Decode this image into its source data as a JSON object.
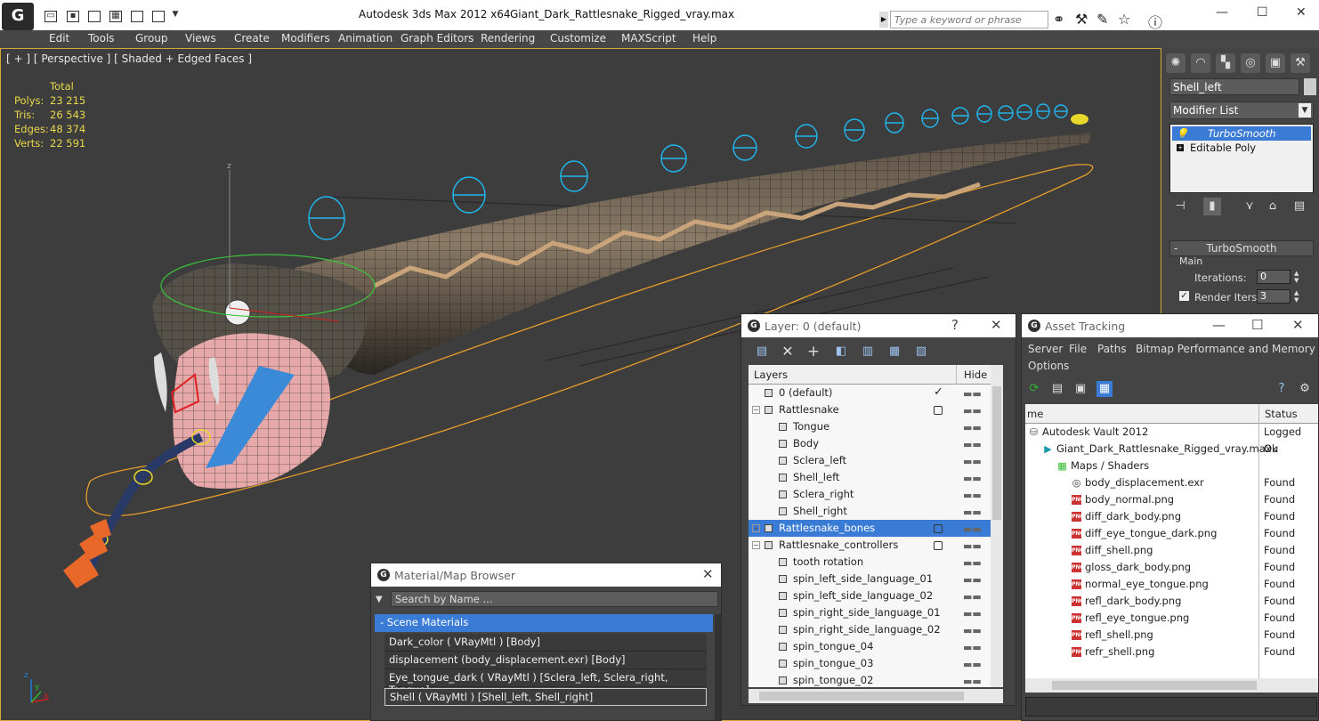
{
  "titlebar": {
    "logo": "G",
    "app_title": "Autodesk 3ds Max  2012 x64",
    "file_title": "Giant_Dark_Rattlesnake_Rigged_vray.max",
    "search_placeholder": "Type a keyword or phrase"
  },
  "menu": [
    "Edit",
    "Tools",
    "Group",
    "Views",
    "Create",
    "Modifiers",
    "Animation",
    "Graph Editors",
    "Rendering",
    "Customize",
    "MAXScript",
    "Help"
  ],
  "viewport": {
    "label": "[ + ] [ Perspective ] [ Shaded + Edged Faces ]",
    "stats_header": "Total",
    "stats": [
      {
        "label": "Polys:",
        "value": "23 215"
      },
      {
        "label": "Tris:",
        "value": "26 543"
      },
      {
        "label": "Edges:",
        "value": "48 374"
      },
      {
        "label": "Verts:",
        "value": "22 591"
      }
    ],
    "axis_z": "z",
    "axis_x": "x",
    "axis_y": "y",
    "highlight_color": "#d7a83a",
    "controller_color": "#1fb8f0"
  },
  "command_panel": {
    "object_name": "Shell_left",
    "modifier_list": "Modifier List",
    "stack": [
      "TurboSmooth",
      "Editable Poly"
    ],
    "rollout_title": "TurboSmooth",
    "rollout_minus": "-",
    "main_label": "Main",
    "iterations_label": "Iterations:",
    "iterations_value": "0",
    "render_iters_label": "Render Iters:",
    "render_iters_value": "3"
  },
  "layer_window": {
    "title": "Layer: 0 (default)",
    "help": "?",
    "close": "✕",
    "col_layers": "Layers",
    "col_hide": "Hide",
    "rows": [
      {
        "name": "0 (default)",
        "level": 0,
        "state": "check"
      },
      {
        "name": "Rattlesnake",
        "level": 0,
        "state": "box",
        "expander": "−"
      },
      {
        "name": "Tongue",
        "level": 1
      },
      {
        "name": "Body",
        "level": 1
      },
      {
        "name": "Sclera_left",
        "level": 1
      },
      {
        "name": "Shell_left",
        "level": 1
      },
      {
        "name": "Sclera_right",
        "level": 1
      },
      {
        "name": "Shell_right",
        "level": 1
      },
      {
        "name": "Rattlesnake_bones",
        "level": 0,
        "state": "box",
        "expander": "+",
        "selected": true
      },
      {
        "name": "Rattlesnake_controllers",
        "level": 0,
        "state": "box",
        "expander": "−"
      },
      {
        "name": "tooth rotation",
        "level": 1
      },
      {
        "name": "spin_left_side_language_01",
        "level": 1
      },
      {
        "name": "spin_left_side_language_02",
        "level": 1
      },
      {
        "name": "spin_right_side_language_01",
        "level": 1
      },
      {
        "name": "spin_right_side_language_02",
        "level": 1
      },
      {
        "name": "spin_tongue_04",
        "level": 1
      },
      {
        "name": "spin_tongue_03",
        "level": 1
      },
      {
        "name": "spin_tongue_02",
        "level": 1
      }
    ],
    "hide_mark": "▬▬"
  },
  "material_browser": {
    "title": "Material/Map Browser",
    "close": "✕",
    "search_placeholder": "Search by Name ...",
    "section": "- Scene Materials",
    "rows": [
      "Dark_color  ( VRayMtl )  [Body]",
      "displacement (body_displacement.exr) [Body]",
      "Eye_tongue_dark  ( VRayMtl )  [Sclera_left, Sclera_right, Tongue]",
      "Shell  ( VRayMtl )  [Shell_left, Shell_right]"
    ]
  },
  "asset_tracking": {
    "title": "Asset Tracking",
    "menu": [
      "Server",
      "File",
      "Paths",
      "Bitmap Performance and Memory",
      "Options"
    ],
    "col_name": "me",
    "col_status": "Status",
    "rows": [
      {
        "name": "Autodesk Vault 2012",
        "status": "Logged Ou",
        "level": 0,
        "icon": "vault"
      },
      {
        "name": "Giant_Dark_Rattlesnake_Rigged_vray.max",
        "status": "Ok",
        "level": 1,
        "icon": "max"
      },
      {
        "name": "Maps / Shaders",
        "status": "",
        "level": 2,
        "icon": "maps"
      },
      {
        "name": "body_displacement.exr",
        "status": "Found",
        "level": 3,
        "icon": "exr"
      },
      {
        "name": "body_normal.png",
        "status": "Found",
        "level": 3,
        "icon": "png"
      },
      {
        "name": "diff_dark_body.png",
        "status": "Found",
        "level": 3,
        "icon": "png"
      },
      {
        "name": "diff_eye_tongue_dark.png",
        "status": "Found",
        "level": 3,
        "icon": "png"
      },
      {
        "name": "diff_shell.png",
        "status": "Found",
        "level": 3,
        "icon": "png"
      },
      {
        "name": "gloss_dark_body.png",
        "status": "Found",
        "level": 3,
        "icon": "png"
      },
      {
        "name": "normal_eye_tongue.png",
        "status": "Found",
        "level": 3,
        "icon": "png"
      },
      {
        "name": "refl_dark_body.png",
        "status": "Found",
        "level": 3,
        "icon": "png"
      },
      {
        "name": "refl_eye_tongue.png",
        "status": "Found",
        "level": 3,
        "icon": "png"
      },
      {
        "name": "refl_shell.png",
        "status": "Found",
        "level": 3,
        "icon": "png"
      },
      {
        "name": "refr_shell.png",
        "status": "Found",
        "level": 3,
        "icon": "png"
      }
    ],
    "png_tag": "PNG"
  }
}
